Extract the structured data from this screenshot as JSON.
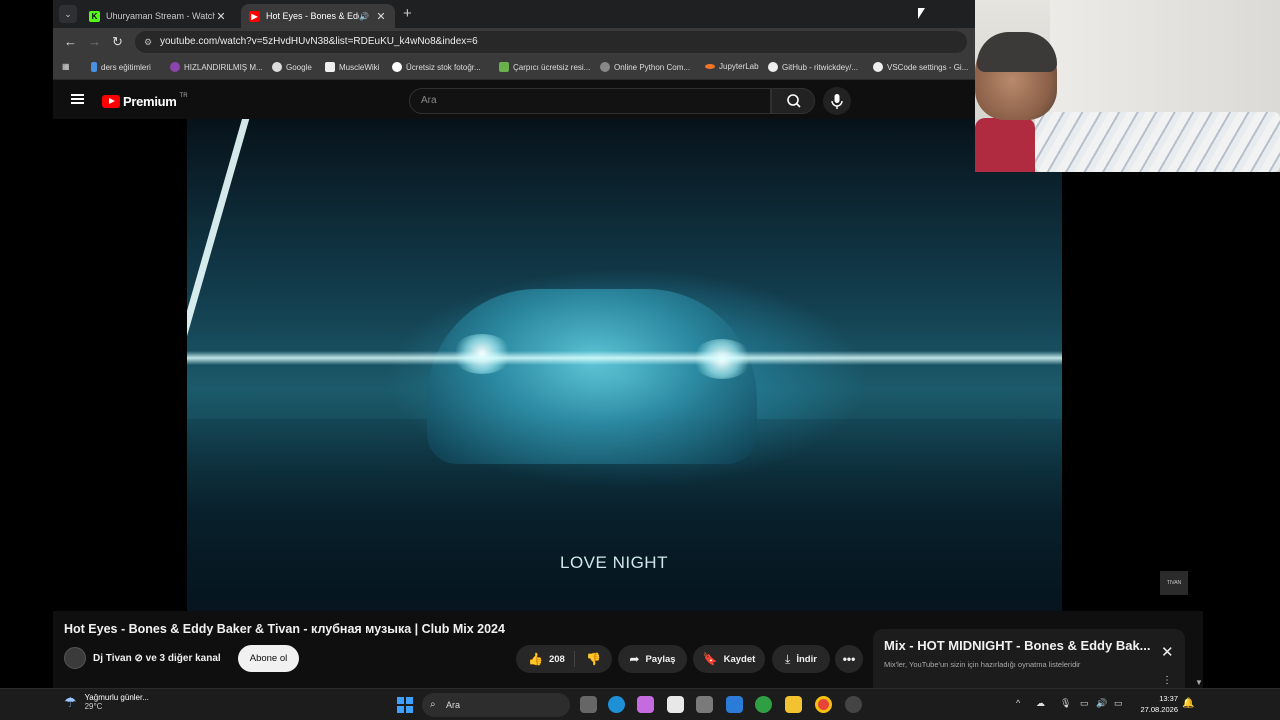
{
  "browser": {
    "tabs": [
      {
        "title": "Uhuryaman Stream - Watch Live",
        "favicon": "kick-icon",
        "active": false
      },
      {
        "title": "Hot Eyes - Bones & Eddy Baker",
        "favicon": "youtube-icon",
        "active": true
      }
    ],
    "url": "youtube.com/watch?v=5zHvdHUvN38&list=RDEuKU_k4wNo8&index=6",
    "bookmarks": [
      "ders eğitimleri",
      "HIZLANDIRILMIŞ M...",
      "Google",
      "MuscleWiki",
      "Ücretsiz stok fotoğr...",
      "Çarpıcı ücretsiz resi...",
      "Online Python Com...",
      "JupyterLab",
      "GitHub - ritwickdey/...",
      "VSCode settings - Gi..."
    ]
  },
  "youtube": {
    "logo_word": "Premium",
    "region": "TR",
    "search_placeholder": "Ara",
    "overlay_text": "LOVE NIGHT",
    "watermark": "TIVAN",
    "video_title": "Hot Eyes - Bones & Eddy Baker & Tivan - клубная музыка | Club Mix 2024",
    "channel": "Dj Tivan ⊘ ve 3 diğer kanal",
    "subscribe": "Abone ol",
    "likes": "208",
    "share": "Paylaş",
    "save": "Kaydet",
    "download": "İndir",
    "more": "•••",
    "mix": {
      "title": "Mix - HOT MIDNIGHT - Bones & Eddy Bak...",
      "subtitle": "Mix'ler, YouTube'un sizin için hazırladığı oynatma listeleridir"
    }
  },
  "taskbar": {
    "weather_title": "Yağmurlu günler...",
    "weather_temp": "29°C",
    "search": "Ara",
    "time": "13:37",
    "date": "27.08.2026"
  },
  "colors": {
    "youtube_red": "#ff0000",
    "windows_blue": "#3ea0ff"
  }
}
